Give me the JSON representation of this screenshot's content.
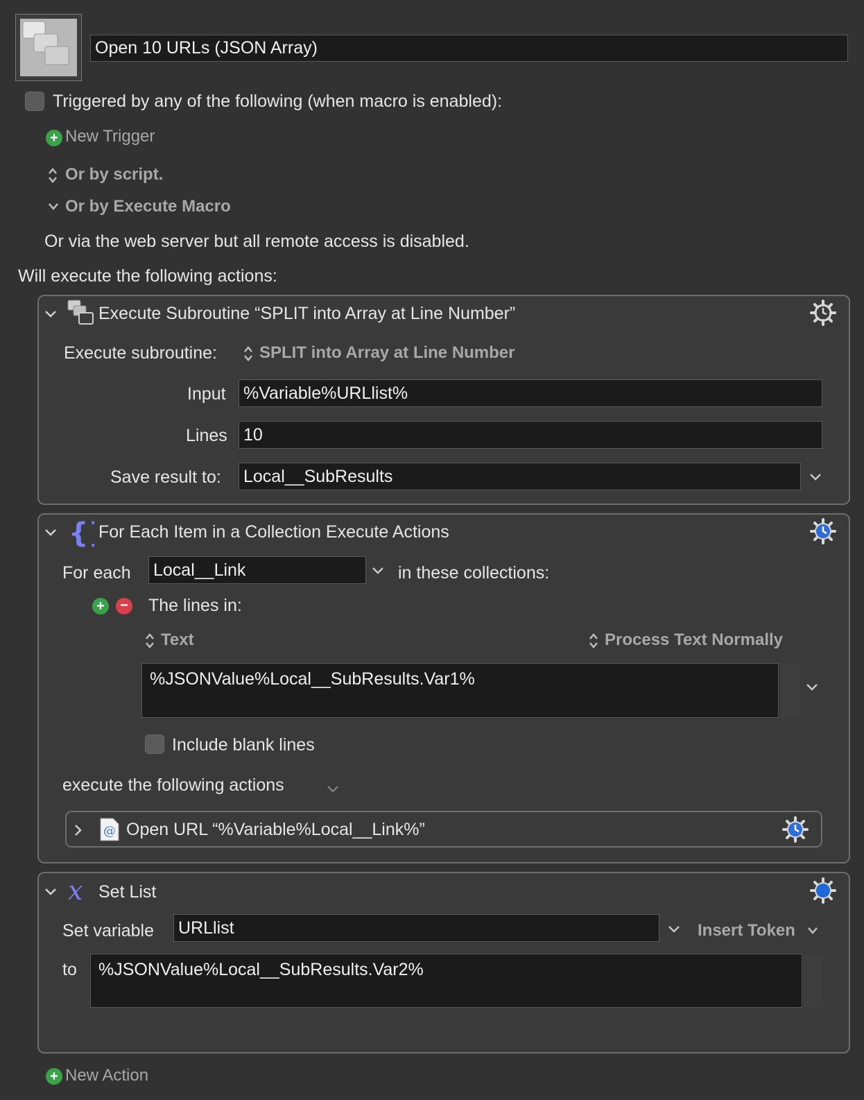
{
  "macro": {
    "name": "Open 10 URLs (JSON Array)"
  },
  "triggers": {
    "header": "Triggered by any of the following (when macro is enabled):",
    "new_trigger": "New Trigger",
    "or_by_script": "Or by script.",
    "or_by_execute_macro": "Or by Execute Macro",
    "web_server_note": "Or via the web server but all remote access is disabled."
  },
  "actions_header": "Will execute the following actions:",
  "action1": {
    "title": "Execute Subroutine “SPLIT into Array at Line Number”",
    "execute_label": "Execute subroutine:",
    "subroutine": "SPLIT into Array at Line Number",
    "input_label": "Input",
    "input_value": "%Variable%URLlist%",
    "lines_label": "Lines",
    "lines_value": "10",
    "save_label": "Save result to:",
    "save_value": "Local__SubResults"
  },
  "action2": {
    "title": "For Each Item in a Collection Execute Actions",
    "for_each_label": "For each",
    "variable": "Local__Link",
    "in_collections": "in these collections:",
    "lines_in": "The lines in:",
    "text_mode": "Text",
    "process_mode": "Process Text Normally",
    "text_value": "%JSONValue%Local__SubResults.Var1%",
    "include_blank": "Include blank lines",
    "execute_following": "execute the following actions",
    "sub_action": "Open URL “%Variable%Local__Link%”"
  },
  "action3": {
    "title": "Set List",
    "set_variable_label": "Set variable",
    "variable_value": "URLlist",
    "insert_token": "Insert Token",
    "to_label": "to",
    "to_value": "%JSONValue%Local__SubResults.Var2%"
  },
  "new_action": "New Action"
}
